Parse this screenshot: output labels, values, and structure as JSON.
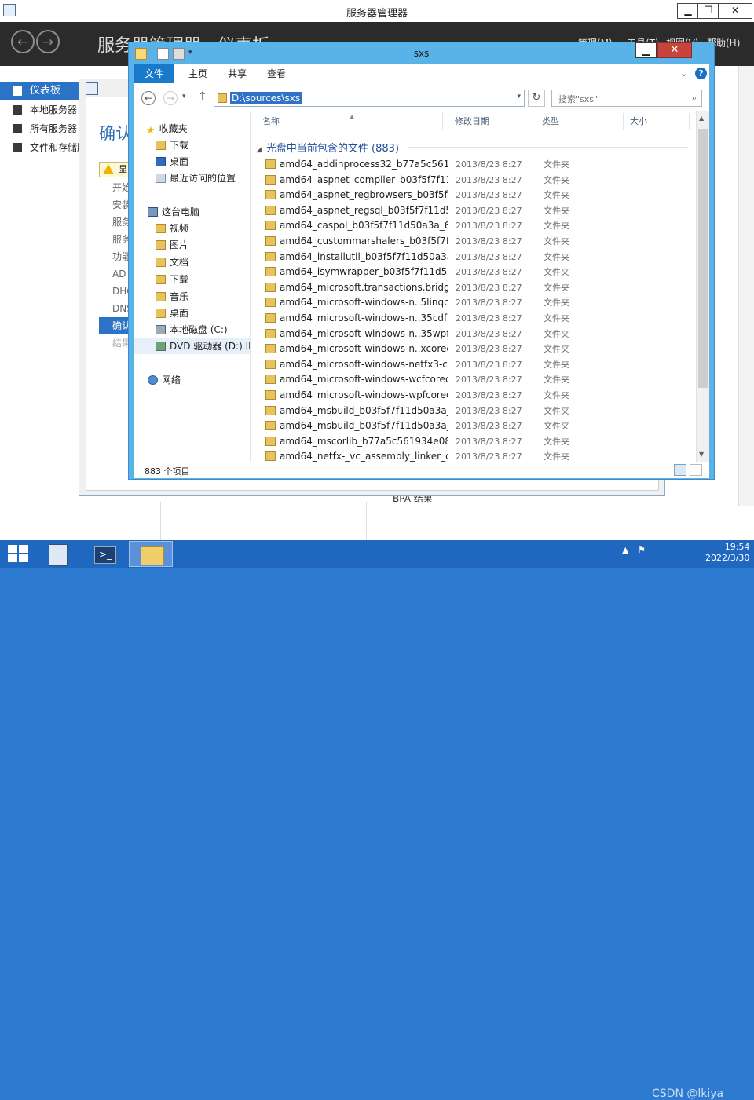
{
  "server_manager": {
    "title": "服务器管理器",
    "breadcrumb": "服务器管理器 · 仪表板",
    "menu": [
      "管理(M)",
      "工具(T)",
      "视图(V)",
      "帮助(H)"
    ],
    "sidebar": [
      "仪表板",
      "本地服务器",
      "所有服务器",
      "文件和存储服务"
    ],
    "controls": [
      "▁",
      "❐",
      "✕"
    ]
  },
  "wizard": {
    "heading": "确认",
    "warning": "显",
    "steps": [
      "开始",
      "安装",
      "服务",
      "服务",
      "功能",
      "AD",
      "DHC",
      "DNS",
      "确认",
      "结果"
    ],
    "current_step_index": 8
  },
  "background_text": {
    "bpa": "BPA 结果"
  },
  "explorer": {
    "title": "sxs",
    "ribbon_tabs": [
      "文件",
      "主页",
      "共享",
      "查看"
    ],
    "address": "D:\\sources\\sxs",
    "search_placeholder": "搜索\"sxs\"",
    "columns": [
      "名称",
      "修改日期",
      "类型",
      "大小"
    ],
    "group_header": "光盘中当前包含的文件 (883)",
    "nav": {
      "favorites_label": "收藏夹",
      "favorites": [
        "下载",
        "桌面",
        "最近访问的位置"
      ],
      "this_pc_label": "这台电脑",
      "this_pc": [
        "视频",
        "图片",
        "文档",
        "下载",
        "音乐",
        "桌面",
        "本地磁盘 (C:)",
        "DVD 驱动器 (D:) IR"
      ],
      "network_label": "网络"
    },
    "files": [
      {
        "name": "amd64_addinprocess32_b77a5c5619...",
        "date": "2013/8/23 8:27",
        "type": "文件夹"
      },
      {
        "name": "amd64_aspnet_compiler_b03f5f7f11d...",
        "date": "2013/8/23 8:27",
        "type": "文件夹"
      },
      {
        "name": "amd64_aspnet_regbrowsers_b03f5f7f...",
        "date": "2013/8/23 8:27",
        "type": "文件夹"
      },
      {
        "name": "amd64_aspnet_regsql_b03f5f7f11d50...",
        "date": "2013/8/23 8:27",
        "type": "文件夹"
      },
      {
        "name": "amd64_caspol_b03f5f7f11d50a3a_6.3...",
        "date": "2013/8/23 8:27",
        "type": "文件夹"
      },
      {
        "name": "amd64_custommarshalers_b03f5f7f1...",
        "date": "2013/8/23 8:27",
        "type": "文件夹"
      },
      {
        "name": "amd64_installutil_b03f5f7f11d50a3a_6...",
        "date": "2013/8/23 8:27",
        "type": "文件夹"
      },
      {
        "name": "amd64_isymwrapper_b03f5f7f11d50a...",
        "date": "2013/8/23 8:27",
        "type": "文件夹"
      },
      {
        "name": "amd64_microsoft.transactions.bridge...",
        "date": "2013/8/23 8:27",
        "type": "文件夹"
      },
      {
        "name": "amd64_microsoft-windows-n..5linqco...",
        "date": "2013/8/23 8:27",
        "type": "文件夹"
      },
      {
        "name": "amd64_microsoft-windows-n..35cdfc...",
        "date": "2013/8/23 8:27",
        "type": "文件夹"
      },
      {
        "name": "amd64_microsoft-windows-n..35wpfc...",
        "date": "2013/8/23 8:27",
        "type": "文件夹"
      },
      {
        "name": "amd64_microsoft-windows-n..xcorec...",
        "date": "2013/8/23 8:27",
        "type": "文件夹"
      },
      {
        "name": "amd64_microsoft-windows-netfx3-co...",
        "date": "2013/8/23 8:27",
        "type": "文件夹"
      },
      {
        "name": "amd64_microsoft-windows-wcfcorec...",
        "date": "2013/8/23 8:27",
        "type": "文件夹"
      },
      {
        "name": "amd64_microsoft-windows-wpfcorec...",
        "date": "2013/8/23 8:27",
        "type": "文件夹"
      },
      {
        "name": "amd64_msbuild_b03f5f7f11d50a3a_3....",
        "date": "2013/8/23 8:27",
        "type": "文件夹"
      },
      {
        "name": "amd64_msbuild_b03f5f7f11d50a3a_6....",
        "date": "2013/8/23 8:27",
        "type": "文件夹"
      },
      {
        "name": "amd64_mscorlib_b77a5c561934e089_...",
        "date": "2013/8/23 8:27",
        "type": "文件夹"
      },
      {
        "name": "amd64_netfx-_vc_assembly_linker_dll_...",
        "date": "2013/8/23 8:27",
        "type": "文件夹"
      }
    ],
    "status": "883 个项目"
  },
  "taskbar": {
    "clock_time": "19:54",
    "clock_date": "2022/3/30",
    "watermark": "CSDN @lkiya"
  },
  "colors": {
    "accent": "#2a73c5",
    "titlebar": "#5ab3e8",
    "taskbar": "#1f67bf",
    "close": "#c7443d"
  }
}
